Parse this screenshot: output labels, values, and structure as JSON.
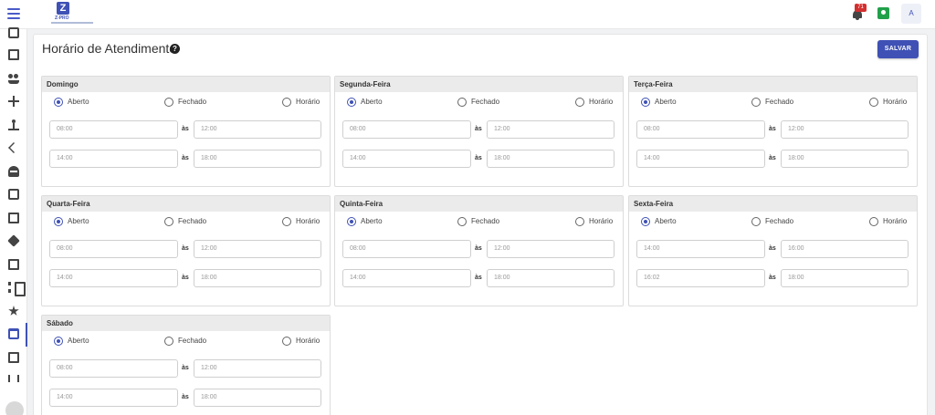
{
  "header": {
    "logo_text": "Z-PRO",
    "notification_count": "71",
    "avatar_initial": "A"
  },
  "page": {
    "title": "Horário de Atendimento",
    "help_glyph": "?",
    "save_label": "SALVAR"
  },
  "options": {
    "open": "Aberto",
    "closed": "Fechado",
    "hours": "Horário"
  },
  "separator": "às",
  "days": [
    {
      "name": "Domingo",
      "selected": "open",
      "t1": "08:00",
      "t2": "12:00",
      "t3": "14:00",
      "t4": "18:00"
    },
    {
      "name": "Segunda-Feira",
      "selected": "open",
      "t1": "08:00",
      "t2": "12:00",
      "t3": "14:00",
      "t4": "18:00"
    },
    {
      "name": "Terça-Feira",
      "selected": "open",
      "t1": "08:00",
      "t2": "12:00",
      "t3": "14:00",
      "t4": "18:00"
    },
    {
      "name": "Quarta-Feira",
      "selected": "open",
      "t1": "08:00",
      "t2": "12:00",
      "t3": "14:00",
      "t4": "18:00"
    },
    {
      "name": "Quinta-Feira",
      "selected": "open",
      "t1": "08:00",
      "t2": "12:00",
      "t3": "14:00",
      "t4": "18:00"
    },
    {
      "name": "Sexta-Feira",
      "selected": "open",
      "t1": "14:00",
      "t2": "16:00",
      "t3": "16:02",
      "t4": "18:00"
    },
    {
      "name": "Sábado",
      "selected": "open",
      "t1": "08:00",
      "t2": "12:00",
      "t3": "14:00",
      "t4": "18:00"
    }
  ],
  "colors": {
    "accent": "#3f51b5",
    "notification": "#d32f2f",
    "contacts": "#21a04a"
  }
}
